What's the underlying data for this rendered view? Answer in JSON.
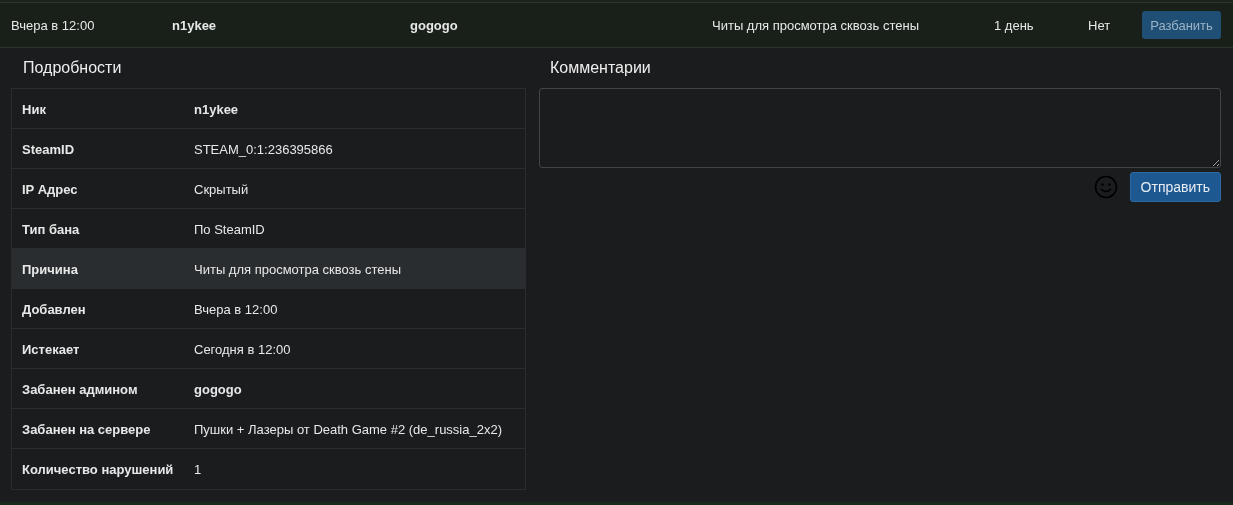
{
  "ban_row": {
    "cells": [
      {
        "text": "Вчера в 12:00",
        "bold": false
      },
      {
        "text": "n1ykee",
        "bold": true
      },
      {
        "text": "gogogo",
        "bold": true
      },
      {
        "text": "Читы для просмотра сквозь стены",
        "bold": false
      },
      {
        "text": "1 день",
        "bold": false
      },
      {
        "text": "Нет",
        "bold": false
      }
    ],
    "button": "Разбанить"
  },
  "details": {
    "title": "Подробности",
    "rows": [
      {
        "label": "Ник",
        "value": "n1ykee",
        "bold": true,
        "selected": false
      },
      {
        "label": "SteamID",
        "value": "STEAM_0:1:236395866",
        "bold": false,
        "selected": false
      },
      {
        "label": "IP Адрес",
        "value": "Скрытый",
        "bold": false,
        "selected": false
      },
      {
        "label": "Тип бана",
        "value": "По SteamID",
        "bold": false,
        "selected": false
      },
      {
        "label": "Причина",
        "value": "Читы для просмотра сквозь стены",
        "bold": false,
        "selected": true
      },
      {
        "label": "Добавлен",
        "value": "Вчера в 12:00",
        "bold": false,
        "selected": false
      },
      {
        "label": "Истекает",
        "value": "Сегодня в 12:00",
        "bold": false,
        "selected": false
      },
      {
        "label": "Забанен админом",
        "value": "gogogo",
        "bold": true,
        "selected": false
      },
      {
        "label": "Забанен на сервере",
        "value": "Пушки + Лазеры от Death Game #2 (de_russia_2x2)",
        "bold": false,
        "selected": false
      },
      {
        "label": "Количество нарушений",
        "value": "1",
        "bold": false,
        "selected": false
      }
    ]
  },
  "comments": {
    "title": "Комментарии",
    "send_button": "Отправить"
  }
}
